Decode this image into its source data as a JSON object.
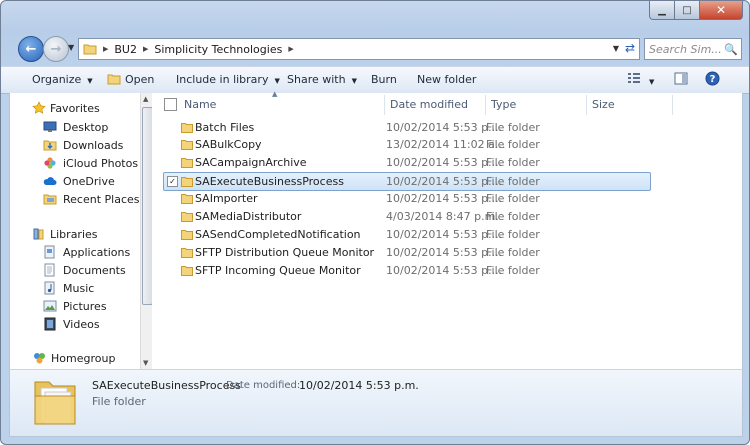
{
  "address": {
    "crumbs": [
      "BU2",
      "Simplicity Technologies"
    ],
    "search_placeholder": "Search Sim..."
  },
  "toolbar": {
    "organize": "Organize",
    "open": "Open",
    "include": "Include in library",
    "share": "Share with",
    "burn": "Burn",
    "new_folder": "New folder"
  },
  "nav": {
    "favorites": "Favorites",
    "desktop": "Desktop",
    "downloads": "Downloads",
    "icloud": "iCloud Photos",
    "onedrive": "OneDrive",
    "recent": "Recent Places",
    "libraries": "Libraries",
    "applications": "Applications",
    "documents": "Documents",
    "music": "Music",
    "pictures": "Pictures",
    "videos": "Videos",
    "homegroup": "Homegroup"
  },
  "columns": {
    "name": "Name",
    "date": "Date modified",
    "type": "Type",
    "size": "Size"
  },
  "files": [
    {
      "name": "Batch Files",
      "date": "10/02/2014 5:53 p....",
      "type": "File folder"
    },
    {
      "name": "SABulkCopy",
      "date": "13/02/2014 11:02 a...",
      "type": "File folder"
    },
    {
      "name": "SACampaignArchive",
      "date": "10/02/2014 5:53 p....",
      "type": "File folder"
    },
    {
      "name": "SAExecuteBusinessProcess",
      "date": "10/02/2014 5:53 p....",
      "type": "File folder"
    },
    {
      "name": "SAImporter",
      "date": "10/02/2014 5:53 p....",
      "type": "File folder"
    },
    {
      "name": "SAMediaDistributor",
      "date": "4/03/2014 8:47 p.m.",
      "type": "File folder"
    },
    {
      "name": "SASendCompletedNotification",
      "date": "10/02/2014 5:53 p....",
      "type": "File folder"
    },
    {
      "name": "SFTP Distribution Queue Monitor",
      "date": "10/02/2014 5:53 p....",
      "type": "File folder"
    },
    {
      "name": "SFTP Incoming Queue Monitor",
      "date": "10/02/2014 5:53 p....",
      "type": "File folder"
    }
  ],
  "details": {
    "name": "SAExecuteBusinessProcess",
    "date_label": "Date modified:",
    "date_value": "10/02/2014 5:53 p.m.",
    "type": "File folder"
  }
}
